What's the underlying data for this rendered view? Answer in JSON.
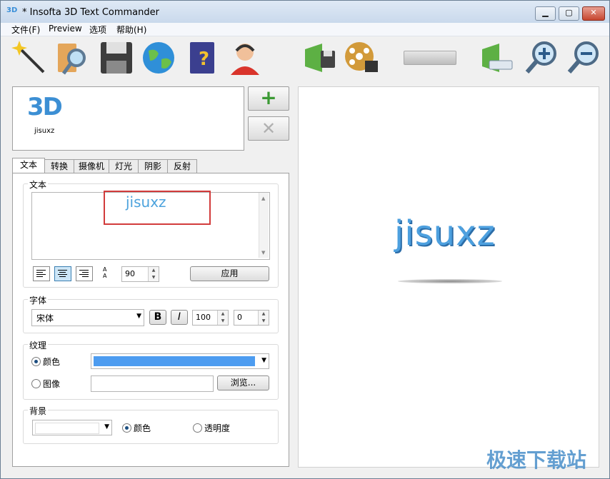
{
  "window": {
    "title": "* Insofta 3D Text Commander",
    "app_icon": "3D"
  },
  "window_controls": {
    "min": "▁",
    "max": "▢",
    "close": "✕"
  },
  "menu": [
    "文件(F)",
    "Preview",
    "选项",
    "帮助(H)"
  ],
  "toolbar": {
    "icons": [
      "wizard-icon",
      "open-folder-icon",
      "save-icon",
      "globe-icon",
      "help-book-icon",
      "support-agent-icon",
      "export-image-icon",
      "export-video-icon",
      "export-file-icon",
      "zoom-in-icon",
      "zoom-out-icon"
    ]
  },
  "thumbnail": {
    "badge": "3D",
    "label": "jisuxz"
  },
  "side_buttons": {
    "add": "+",
    "delete": "✕"
  },
  "tabs": [
    "文本",
    "转换",
    "摄像机",
    "灯光",
    "阴影",
    "反射"
  ],
  "text_group": {
    "label": "文本",
    "content": "jisuxz",
    "line_spacing": "90",
    "apply_label": "应用",
    "scroll_up": "▲",
    "scroll_down": "▼"
  },
  "font_group": {
    "label": "字体",
    "font_name": "宋体",
    "bold_label": "B",
    "italic_label": "I",
    "size": "100",
    "offset": "0"
  },
  "texture_group": {
    "label": "纹理",
    "color_label": "颜色",
    "image_label": "图像",
    "image_path": "",
    "browse_label": "浏览...",
    "color_value": "#4d9cf0"
  },
  "background_group": {
    "label": "背景",
    "color_label": "颜色",
    "transparency_label": "透明度"
  },
  "preview": {
    "text": "jisuxz"
  },
  "watermark": "极速下载站",
  "spinner_arrows": {
    "up": "▲",
    "down": "▼"
  },
  "combo_arrow": "▼"
}
